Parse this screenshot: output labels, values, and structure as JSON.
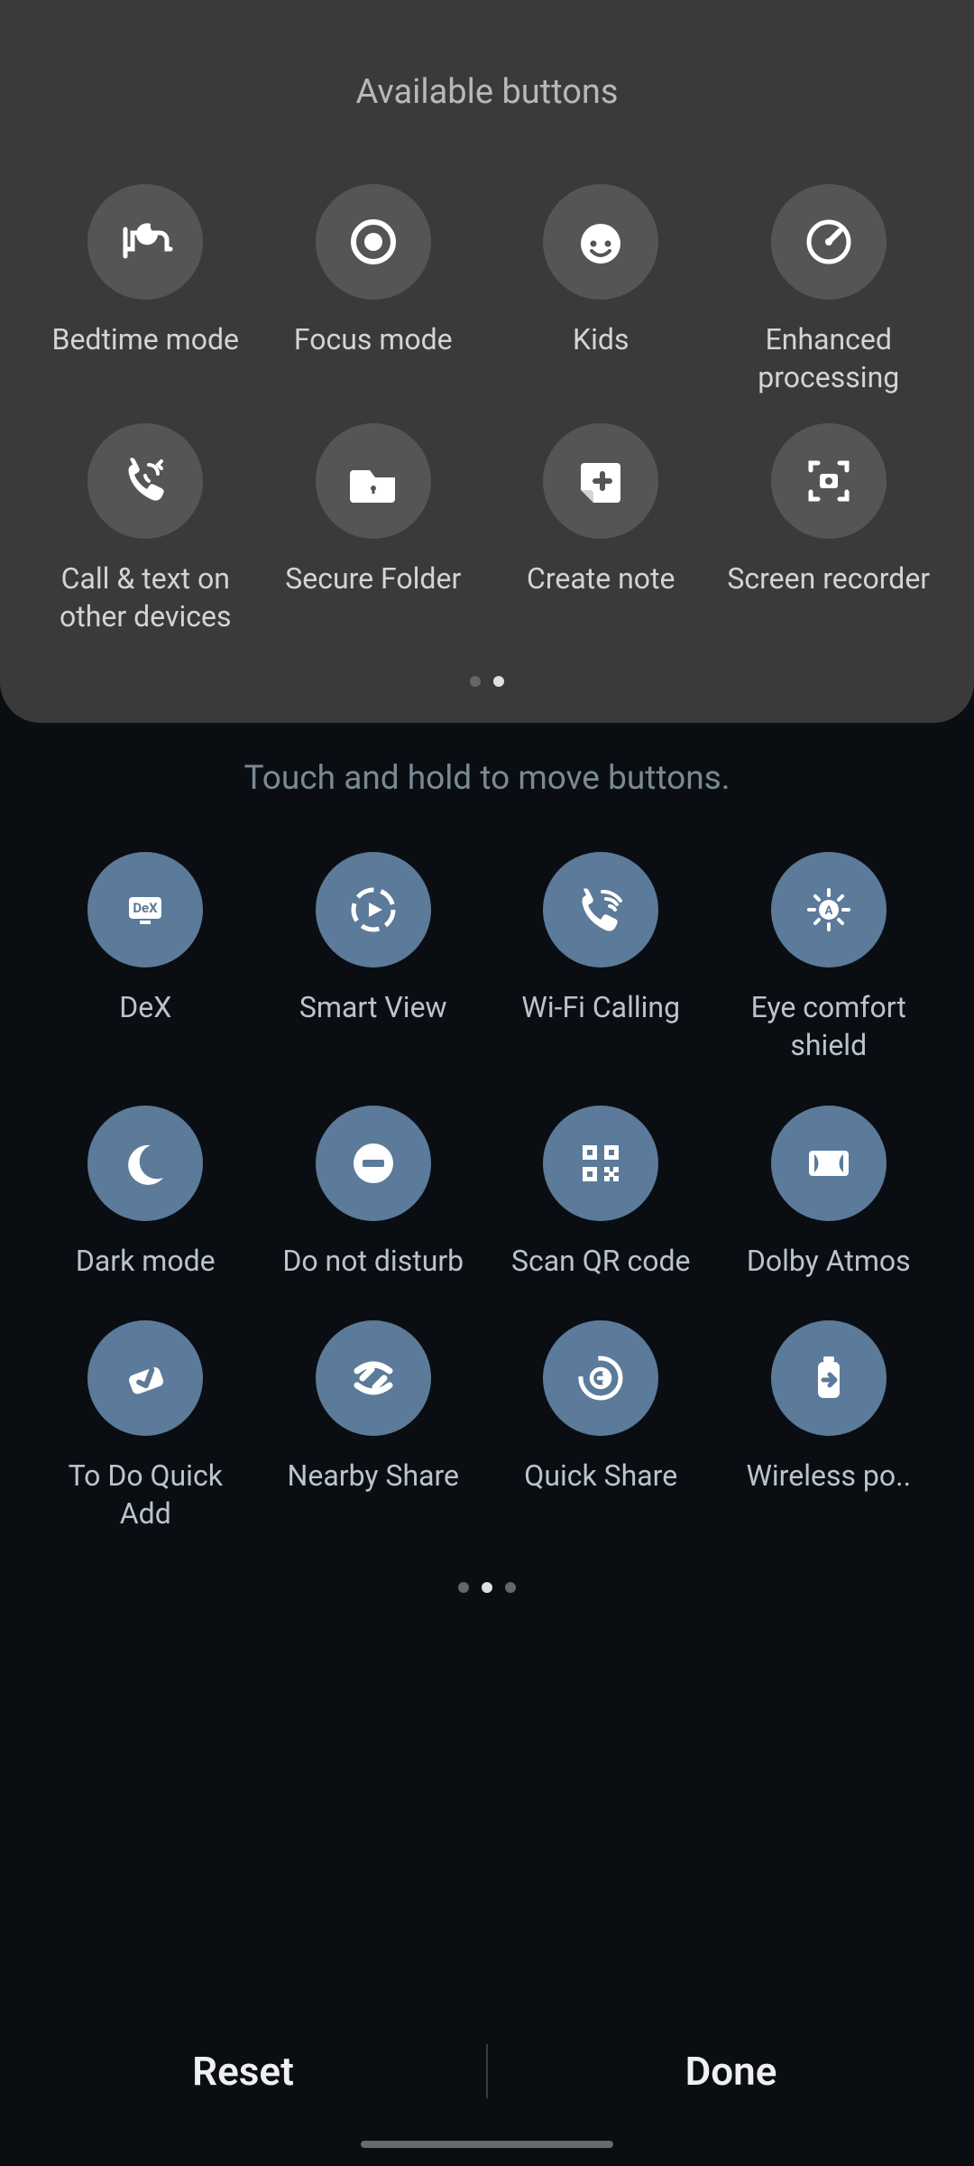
{
  "available": {
    "title": "Available buttons",
    "tiles": [
      {
        "id": "bedtime-mode",
        "label": "Bedtime mode",
        "icon": "bed"
      },
      {
        "id": "focus-mode",
        "label": "Focus mode",
        "icon": "target"
      },
      {
        "id": "kids",
        "label": "Kids",
        "icon": "kid-face"
      },
      {
        "id": "enhanced-processing",
        "label": "Enhanced processing",
        "icon": "gauge"
      },
      {
        "id": "call-text-other-devices",
        "label": "Call & text on other devices",
        "icon": "phone-sync"
      },
      {
        "id": "secure-folder",
        "label": "Secure Folder",
        "icon": "folder-lock"
      },
      {
        "id": "create-note",
        "label": "Create note",
        "icon": "note-plus"
      },
      {
        "id": "screen-recorder",
        "label": "Screen recorder",
        "icon": "camera-frame"
      }
    ],
    "pager": {
      "count": 2,
      "active": 1
    }
  },
  "hint": "Touch and hold to move buttons.",
  "active": {
    "tiles": [
      {
        "id": "dex",
        "label": "DeX",
        "icon": "dex"
      },
      {
        "id": "smart-view",
        "label": "Smart View",
        "icon": "smart-view"
      },
      {
        "id": "wifi-calling",
        "label": "Wi-Fi Calling",
        "icon": "wifi-call"
      },
      {
        "id": "eye-comfort-shield",
        "label": "Eye comfort shield",
        "icon": "eye-shield"
      },
      {
        "id": "dark-mode",
        "label": "Dark mode",
        "icon": "moon"
      },
      {
        "id": "do-not-disturb",
        "label": "Do not disturb",
        "icon": "dnd"
      },
      {
        "id": "scan-qr-code",
        "label": "Scan QR code",
        "icon": "qr"
      },
      {
        "id": "dolby-atmos",
        "label": "Dolby Atmos",
        "icon": "dolby"
      },
      {
        "id": "todo-quick-add",
        "label": "To Do Quick Add",
        "icon": "check"
      },
      {
        "id": "nearby-share",
        "label": "Nearby Share",
        "icon": "nearby"
      },
      {
        "id": "quick-share",
        "label": "Quick Share",
        "icon": "quick-share"
      },
      {
        "id": "wireless-power-share",
        "label": "Wireless po..",
        "icon": "battery-arrow"
      }
    ],
    "pager": {
      "count": 3,
      "active": 1
    }
  },
  "footer": {
    "reset": "Reset",
    "done": "Done"
  }
}
